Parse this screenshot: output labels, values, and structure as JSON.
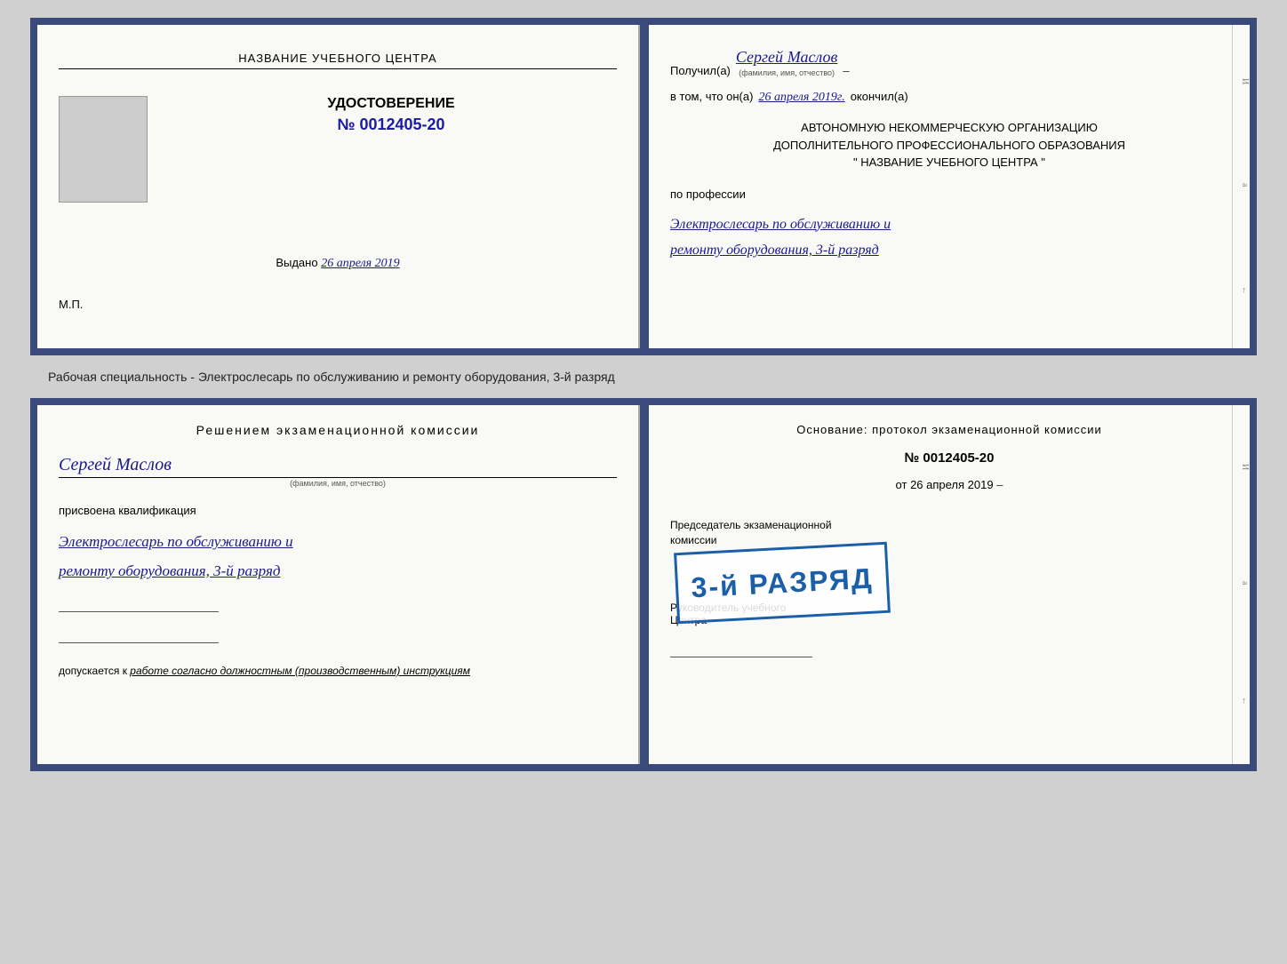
{
  "doc1": {
    "left": {
      "school_title": "НАЗВАНИЕ УЧЕБНОГО ЦЕНТРА",
      "udostoverenie_label": "УДОСТОВЕРЕНИЕ",
      "cert_number": "№ 0012405-20",
      "vydano_label": "Выдано",
      "vydano_date": "26 апреля 2019",
      "mp_label": "М.П."
    },
    "right": {
      "received_label": "Получил(а)",
      "received_name": "Сергей Маслов",
      "name_subtitle": "(фамилия, имя, отчество)",
      "vtom_label": "в том, что он(а)",
      "vtom_date": "26 апреля 2019г.",
      "okonchil_label": "окончил(а)",
      "org_line1": "АВТОНОМНУЮ НЕКОММЕРЧЕСКУЮ ОРГАНИЗАЦИЮ",
      "org_line2": "ДОПОЛНИТЕЛЬНОГО ПРОФЕССИОНАЛЬНОГО ОБРАЗОВАНИЯ",
      "org_line3": "\"  НАЗВАНИЕ УЧЕБНОГО ЦЕНТРА   \"",
      "po_professii_label": "по профессии",
      "profession_line1": "Электрослесарь по обслуживанию и",
      "profession_line2": "ремонту оборудования, 3-й разряд"
    }
  },
  "middle_text": "Рабочая специальность - Электрослесарь по обслуживанию и ремонту оборудования, 3-й разряд",
  "doc2": {
    "left": {
      "resheniyem_title": "Решением  экзаменационной  комиссии",
      "person_name": "Сергей Маслов",
      "fio_subtitle": "(фамилия, имя, отчество)",
      "prisvoena_label": "присвоена квалификация",
      "qualification_line1": "Электрослесарь по обслуживанию и",
      "qualification_line2": "ремонту оборудования, 3-й разряд",
      "dopuskaetsya_label": "допускается к",
      "dopuskaetsya_value": "работе согласно должностным (производственным) инструкциям"
    },
    "right": {
      "osnovanie_text": "Основание: протокол экзаменационной комиссии",
      "protocol_number": "№  0012405-20",
      "ot_label": "от",
      "ot_date": "26 апреля 2019",
      "predsedatel_label": "Председатель экзаменационной\nкомиссии",
      "stamp_text": "3-й РАЗРЯД",
      "rukovoditel_label": "Руководитель учебного\nЦентра"
    }
  }
}
